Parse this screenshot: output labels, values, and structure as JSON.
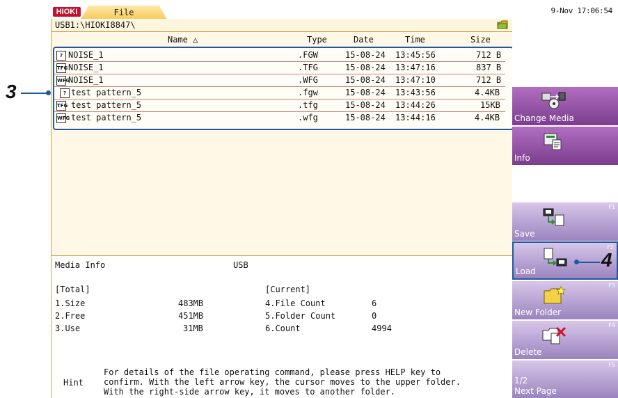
{
  "header": {
    "logo": "HIOKI",
    "tab_label": "File",
    "clock": "9-Nov 17:06:54"
  },
  "path": {
    "text": "USB1:\\HIOKI8847\\"
  },
  "columns": {
    "name": "Name △",
    "type": "Type",
    "date": "Date",
    "time": "Time",
    "size": "Size"
  },
  "files": [
    {
      "icon": "?",
      "icon_name": "unknown-file-icon",
      "name": "NOISE_1",
      "type": ".FGW",
      "date": "15-08-24",
      "time": "13:45:56",
      "size": "712 B"
    },
    {
      "icon": "TFG",
      "icon_name": "tfg-file-icon",
      "name": "NOISE_1",
      "type": ".TFG",
      "date": "15-08-24",
      "time": "13:47:16",
      "size": "837 B"
    },
    {
      "icon": "WFG",
      "icon_name": "wfg-file-icon",
      "name": "NOISE_1",
      "type": ".WFG",
      "date": "15-08-24",
      "time": "13:47:10",
      "size": "712 B"
    },
    {
      "icon": "?",
      "icon_name": "unknown-file-icon",
      "name": "test pattern_5",
      "type": ".fgw",
      "date": "15-08-24",
      "time": "13:43:56",
      "size": "4.4KB"
    },
    {
      "icon": "TFG",
      "icon_name": "tfg-file-icon",
      "name": "test pattern_5",
      "type": ".tfg",
      "date": "15-08-24",
      "time": "13:44:26",
      "size": "15KB"
    },
    {
      "icon": "WFG",
      "icon_name": "wfg-file-icon",
      "name": "test pattern_5",
      "type": ".wfg",
      "date": "15-08-24",
      "time": "13:44:16",
      "size": "4.4KB"
    }
  ],
  "media_info": {
    "title": "Media Info",
    "media": "USB",
    "total_label": "[Total]",
    "current_label": "[Current]",
    "size_label": "1.Size",
    "size_value": "483MB",
    "free_label": "2.Free",
    "free_value": "451MB",
    "use_label": "3.Use",
    "use_value": "31MB",
    "file_count_label": "4.File Count",
    "file_count_value": "6",
    "folder_count_label": "5.Folder Count",
    "folder_count_value": "0",
    "count_label": "6.Count",
    "count_value": "4994"
  },
  "hint": {
    "label": "Hint",
    "line1": "For details of the file operating command, please press HELP key to",
    "line2": "confirm. With the left arrow key, the cursor moves to the upper folder.",
    "line3": "With the right-side arrow key, it moves to another folder."
  },
  "side": {
    "change_media": "Change Media",
    "info": "Info",
    "save": "Save",
    "save_key": "F1",
    "load": "Load",
    "load_key": "F2",
    "new_folder": "New Folder",
    "new_folder_key": "F3",
    "delete": "Delete",
    "delete_key": "F4",
    "next_page_num": "1/2",
    "next_page": "Next Page",
    "next_page_key": "F5"
  },
  "callouts": {
    "left": "3",
    "right": "4"
  },
  "colors": {
    "selection_border": "#1f5a9e",
    "button_purple": "#7c3d8e",
    "button_lilac": "#9b84bf",
    "screen_bg": "#fff8e6"
  }
}
